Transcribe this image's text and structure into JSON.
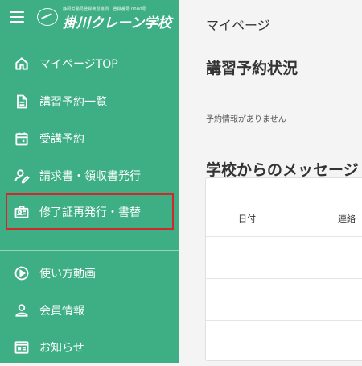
{
  "brand": {
    "tagline": "静岡労働局登録教習機関　登録番号 0000号",
    "name": "掛川クレーン学校"
  },
  "sidebar": {
    "items": [
      {
        "label": "マイページTOP",
        "icon": "home-icon"
      },
      {
        "label": "講習予約一覧",
        "icon": "document-icon"
      },
      {
        "label": "受講予約",
        "icon": "calendar-icon"
      },
      {
        "label": "請求書・領収書発行",
        "icon": "person-edit-icon"
      },
      {
        "label": "修了証再発行・書替",
        "icon": "certificate-icon"
      },
      {
        "label": "使い方動画",
        "icon": "play-circle-icon"
      },
      {
        "label": "会員情報",
        "icon": "person-icon"
      },
      {
        "label": "お知らせ",
        "icon": "news-icon"
      }
    ],
    "highlight_color": "#d1272d"
  },
  "main": {
    "page_title": "マイページ",
    "reservation_section": {
      "title": "講習予約状況",
      "empty_message": "予約情報がありません"
    },
    "message_section": {
      "title": "学校からのメッセージ",
      "columns": [
        "日付",
        "連絡"
      ]
    }
  },
  "colors": {
    "sidebar": "#3eaf84",
    "background": "#f4f4f4"
  }
}
